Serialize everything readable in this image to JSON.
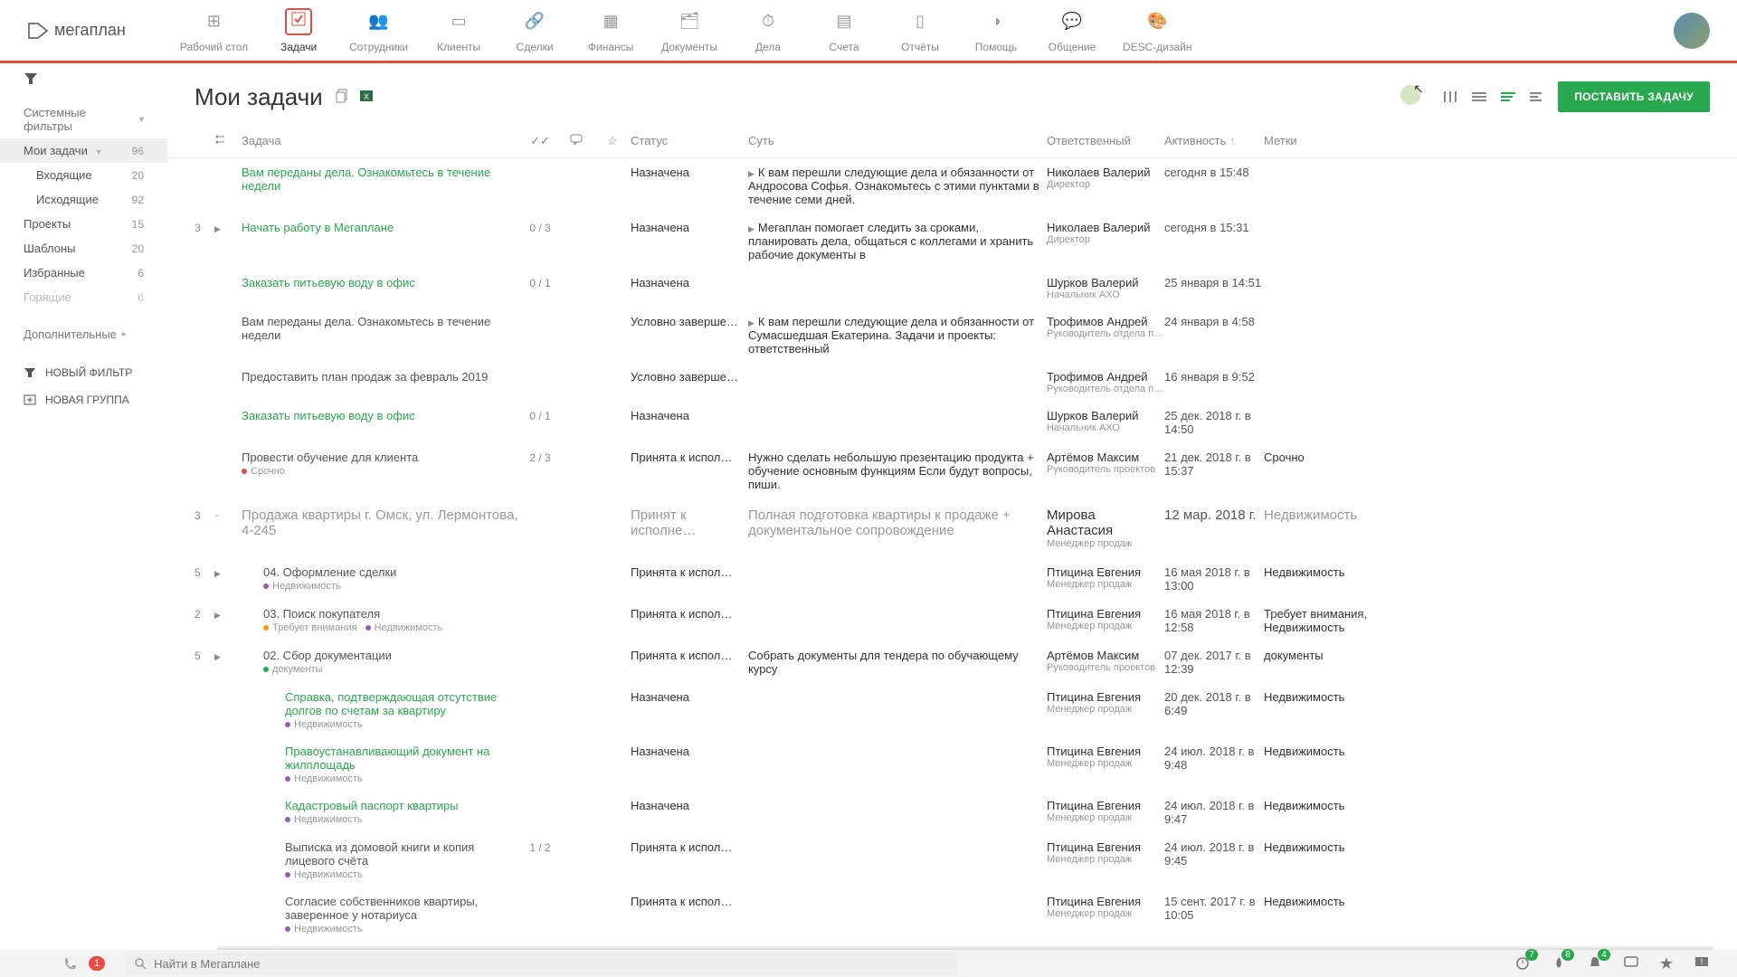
{
  "nav": [
    "Рабочий стол",
    "Задачи",
    "Сотрудники",
    "Клиенты",
    "Сделки",
    "Финансы",
    "Документы",
    "Дела",
    "Счета",
    "Отчёты",
    "Помощь",
    "Общение",
    "DESC-дизайн"
  ],
  "logo": "мегаплан",
  "page_title": "Мои задачи",
  "create_btn": "ПОСТАВИТЬ ЗАДАЧУ",
  "sidebar": {
    "group1": "Системные фильтры",
    "items1": [
      {
        "label": "Мои задачи",
        "cnt": "96",
        "sel": true,
        "chev": true
      },
      {
        "label": "Входящие",
        "cnt": "20",
        "indent": true
      },
      {
        "label": "Исходящие",
        "cnt": "92",
        "indent": true
      },
      {
        "label": "Проекты",
        "cnt": "15"
      },
      {
        "label": "Шаблоны",
        "cnt": "20"
      },
      {
        "label": "Избранные",
        "cnt": "6"
      },
      {
        "label": "Горящие",
        "cnt": "0",
        "muted": true
      }
    ],
    "group2": "Дополнительные",
    "new_filter": "НОВЫЙ ФИЛЬТР",
    "new_group": "НОВАЯ ГРУППА"
  },
  "columns": {
    "task": "Задача",
    "status": "Статус",
    "essence": "Суть",
    "resp": "Ответственный",
    "activity": "Активность",
    "tags": "Метки"
  },
  "rows": [
    {
      "title": "Вам переданы дела. Ознакомьтесь в течение недели",
      "green": true,
      "status": "Назначена",
      "essenceTri": true,
      "essence": "К вам перешли следующие дела и обязанности от Андросова Софья. Ознакомьтесь с этими пунктами в течение семи дней.",
      "resp": "Николаев Валерий",
      "role": "Директор",
      "act": "сегодня в 15:48"
    },
    {
      "badge": "3",
      "tri": true,
      "title": "Начать работу в Мегаплане",
      "green": true,
      "ratio": "0 / 3",
      "status": "Назначена",
      "essenceTri": true,
      "essence": "Мегаплан помогает следить за сроками, планировать дела, общаться с коллегами и хранить рабочие документы в",
      "resp": "Николаев Валерий",
      "role": "Директор",
      "act": "сегодня в 15:31"
    },
    {
      "title": "Заказать питьевую воду в офис",
      "green": true,
      "ratio": "0 / 1",
      "status": "Назначена",
      "resp": "Шурков Валерий",
      "role": "Начальник АХО",
      "act": "25 января в 14:51"
    },
    {
      "title": "Вам переданы дела. Ознакомьтесь в течение недели",
      "green": false,
      "status": "Условно заверше…",
      "essenceTri": true,
      "essence": "К вам перешли следующие дела и обязанности от Сумасшедшая Екатерина. Задачи и проекты: ответственный",
      "resp": "Трофимов Андрей",
      "role": "Руководитель отдела п…",
      "act": "24 января в 4:58"
    },
    {
      "title": "Предоставить план продаж за февраль 2019",
      "green": false,
      "status": "Условно заверше…",
      "resp": "Трофимов Андрей",
      "role": "Руководитель отдела п…",
      "act": "16 января в 9:52"
    },
    {
      "title": "Заказать питьевую воду в офис",
      "green": true,
      "ratio": "0 / 1",
      "status": "Назначена",
      "resp": "Шурков Валерий",
      "role": "Начальник АХО",
      "act": "25 дек. 2018 г. в 14:50"
    },
    {
      "title": "Провести обучение для клиента",
      "green": false,
      "ratio": "2 / 3",
      "status": "Принята к испол…",
      "essence": "Нужно сделать небольшую презентацию продукта + обучение основным функциям Если будут вопросы, пиши.",
      "resp": "Артёмов Максим",
      "role": "Руководитель проектов",
      "act": "21 дек. 2018 г. в 15:37",
      "tags": "Срочно",
      "subtags": [
        {
          "t": "Срочно",
          "c": "red"
        }
      ]
    },
    {
      "group": true,
      "badge": "3",
      "title": "Продажа квартиры г. Омск, ул. Лермонтова, 4-245",
      "status": "Принят к исполне…",
      "essence": "Полная подготовка квартиры к продаже + документальное сопровождение",
      "resp": "Мирова Анастасия",
      "role": "Менеджер продаж",
      "act": "12 мар. 2018 г.",
      "tags": "Недвижимость"
    },
    {
      "badge": "5",
      "tri": true,
      "indent": 1,
      "title": "04. Оформление сделки",
      "green": false,
      "status": "Принята к испол…",
      "resp": "Птицина Евгения",
      "role": "Менеджер продаж",
      "act": "16 мая 2018 г. в 13:00",
      "tags": "Недвижимость",
      "subtags": [
        {
          "t": "Недвижимость",
          "c": "purple"
        }
      ]
    },
    {
      "badge": "2",
      "tri": true,
      "indent": 1,
      "title": "03. Поиск покупателя",
      "green": false,
      "status": "Принята к испол…",
      "resp": "Птицина Евгения",
      "role": "Менеджер продаж",
      "act": "16 мая 2018 г. в 12:58",
      "tags": "Требует внимания, Недвижимость",
      "subtags": [
        {
          "t": "Требует внимания",
          "c": "orange"
        },
        {
          "t": "Недвижимость",
          "c": "purple"
        }
      ]
    },
    {
      "badge": "5",
      "tri": true,
      "indent": 1,
      "title": "02. Сбор документации",
      "green": false,
      "status": "Принята к испол…",
      "essence": "Собрать документы для тендера по обучающему курсу",
      "resp": "Артёмов Максим",
      "role": "Руководитель проектов",
      "act": "07 дек. 2017 г. в 12:39",
      "tags": "документы",
      "subtags": [
        {
          "t": "документы",
          "c": "green"
        }
      ]
    },
    {
      "indent": 2,
      "title": "Справка, подтверждающая отсутствие долгов по счетам за квартиру",
      "green": true,
      "status": "Назначена",
      "resp": "Птицина Евгения",
      "role": "Менеджер продаж",
      "act": "20 дек. 2018 г. в 6:49",
      "tags": "Недвижимость",
      "subtags": [
        {
          "t": "Недвижимость",
          "c": "purple"
        }
      ]
    },
    {
      "indent": 2,
      "title": "Правоустанавливающий документ на жилплощадь",
      "green": true,
      "status": "Назначена",
      "resp": "Птицина Евгения",
      "role": "Менеджер продаж",
      "act": "24 июл. 2018 г. в 9:48",
      "tags": "Недвижимость",
      "subtags": [
        {
          "t": "Недвижимость",
          "c": "purple"
        }
      ]
    },
    {
      "indent": 2,
      "title": "Кадастровый паспорт квартиры",
      "green": true,
      "status": "Назначена",
      "resp": "Птицина Евгения",
      "role": "Менеджер продаж",
      "act": "24 июл. 2018 г. в 9:47",
      "tags": "Недвижимость",
      "subtags": [
        {
          "t": "Недвижимость",
          "c": "purple"
        }
      ]
    },
    {
      "indent": 2,
      "title": "Выписка из домовой книги и копия лицевого счёта",
      "green": false,
      "ratio": "1 / 2",
      "status": "Принята к испол…",
      "resp": "Птицина Евгения",
      "role": "Менеджер продаж",
      "act": "24 июл. 2018 г. в 9:45",
      "tags": "Недвижимость",
      "subtags": [
        {
          "t": "Недвижимость",
          "c": "purple"
        }
      ]
    },
    {
      "indent": 2,
      "title": "Согласие собственников квартиры, заверенное у нотариуса",
      "green": false,
      "status": "Принята к испол…",
      "resp": "Птицина Евгения",
      "role": "Менеджер продаж",
      "act": "15 сент. 2017 г. в 10:05",
      "tags": "Недвижимость",
      "subtags": [
        {
          "t": "Недвижимость",
          "c": "purple"
        }
      ]
    }
  ],
  "bottom": {
    "phone_badge": "1",
    "search_ph": "Найти в Мегаплане",
    "b1": "7",
    "b2": "8",
    "b3": "4"
  }
}
